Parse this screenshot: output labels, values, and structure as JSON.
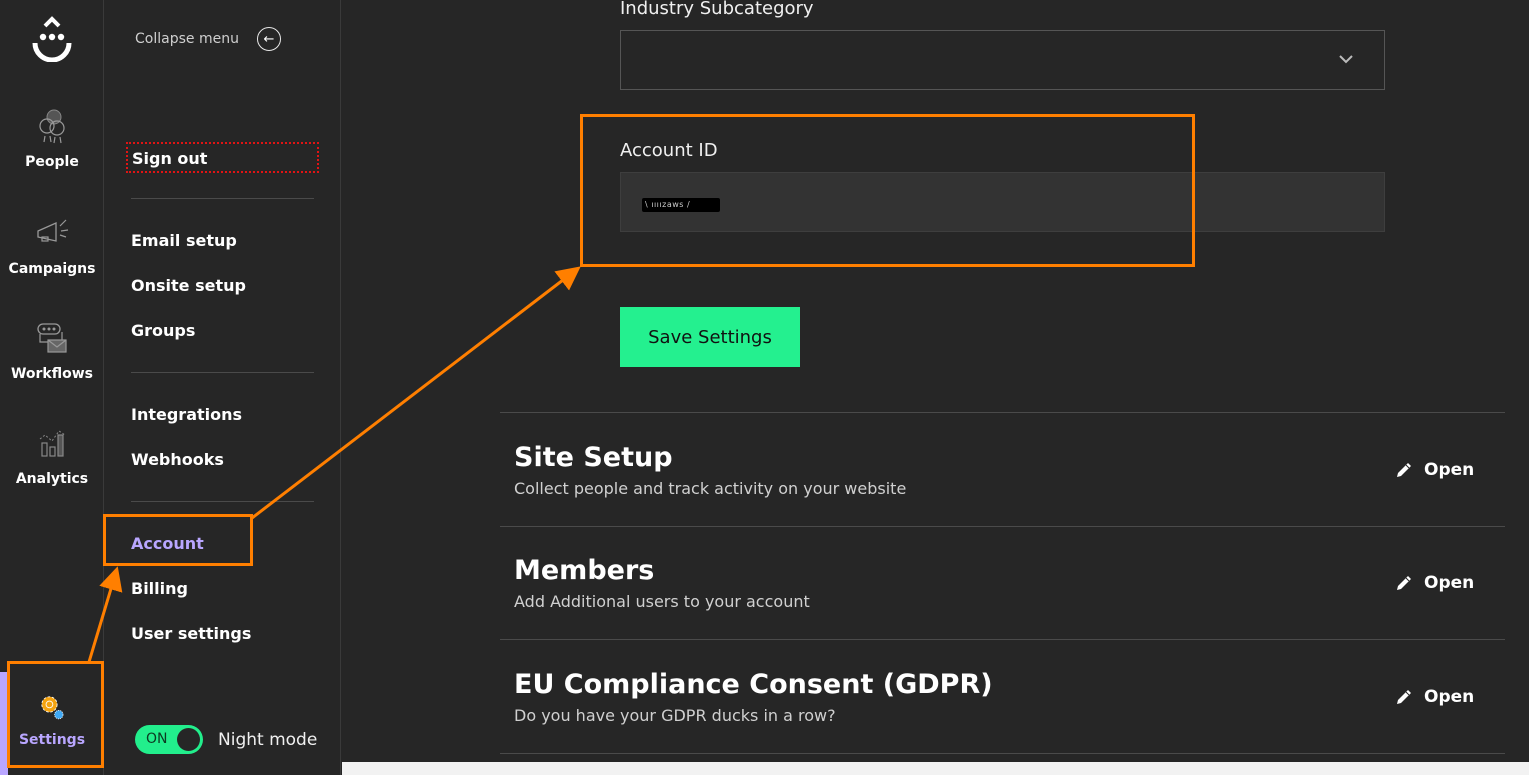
{
  "rail": {
    "logo": "smiley-drop-logo",
    "items": [
      {
        "label": "People",
        "icon": "people-icon"
      },
      {
        "label": "Campaigns",
        "icon": "megaphone-icon"
      },
      {
        "label": "Workflows",
        "icon": "workflow-icon"
      },
      {
        "label": "Analytics",
        "icon": "analytics-icon"
      },
      {
        "label": "Settings",
        "icon": "gear-icon",
        "active": true
      }
    ]
  },
  "menu": {
    "collapse_label": "Collapse menu",
    "collapse_icon": "←",
    "sign_out": "Sign out",
    "group1": [
      "Email setup",
      "Onsite setup",
      "Groups"
    ],
    "group2": [
      "Integrations",
      "Webhooks"
    ],
    "group3": [
      "Account",
      "Billing",
      "User settings"
    ],
    "active_item": "Account",
    "night_mode": {
      "toggle_text": "ON",
      "label": "Night mode",
      "enabled": true
    }
  },
  "main": {
    "industry_subcategory": {
      "label": "Industry Subcategory",
      "value": ""
    },
    "account_id": {
      "label": "Account ID",
      "value": "redacted"
    },
    "save_button": "Save Settings",
    "sections": [
      {
        "title": "Site Setup",
        "description": "Collect people and track activity on your website",
        "action": "Open"
      },
      {
        "title": "Members",
        "description": "Add Additional users to your account",
        "action": "Open"
      },
      {
        "title": "EU Compliance Consent (GDPR)",
        "description": "Do you have your GDPR ducks in a row?",
        "action": "Open"
      }
    ]
  },
  "colors": {
    "background": "#262626",
    "accent_green": "#24f08f",
    "active_purple": "#b9a6ff",
    "annotation_orange": "#ff7f00",
    "signout_outline": "#e01414"
  }
}
